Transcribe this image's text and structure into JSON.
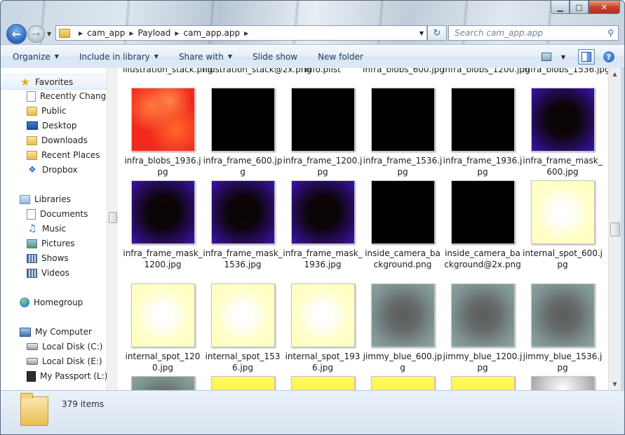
{
  "window": {
    "caption_buttons": {
      "minimize": "▁",
      "maximize": "□",
      "close": "✕"
    }
  },
  "address": {
    "crumbs": [
      "cam_app",
      "Payload",
      "cam_app.app"
    ]
  },
  "search": {
    "placeholder": "Search cam_app.app"
  },
  "toolbar": {
    "organize": "Organize",
    "include_in_library": "Include in library",
    "share_with": "Share with",
    "slide_show": "Slide show",
    "new_folder": "New folder"
  },
  "sidebar": {
    "favorites": "Favorites",
    "favorites_items": [
      "Recently Changed",
      "Public",
      "Desktop",
      "Downloads",
      "Recent Places",
      "Dropbox"
    ],
    "libraries": "Libraries",
    "libraries_items": [
      "Documents",
      "Music",
      "Pictures",
      "Shows",
      "Videos"
    ],
    "homegroup": "Homegroup",
    "computer": "My Computer",
    "computer_items": [
      "Local Disk (C:)",
      "Local Disk (E:)",
      "My Passport (L:)"
    ]
  },
  "files": {
    "partial_row": [
      "illustration_stack.png",
      "illustration_stack@2x.png",
      "Info.plist",
      "infra_blobs_600.jpg",
      "infra_blobs_1200.jpg",
      "infra_blobs_1536.jpg"
    ],
    "rows": [
      [
        {
          "name": "infra_blobs_1936.jpg",
          "thumb": "red-blobs"
        },
        {
          "name": "infra_frame_600.jpg",
          "thumb": "black"
        },
        {
          "name": "infra_frame_1200.jpg",
          "thumb": "black"
        },
        {
          "name": "infra_frame_1536.jpg",
          "thumb": "black"
        },
        {
          "name": "infra_frame_1936.jpg",
          "thumb": "black"
        },
        {
          "name": "infra_frame_mask_600.jpg",
          "thumb": "purple-vignette"
        }
      ],
      [
        {
          "name": "infra_frame_mask_1200.jpg",
          "thumb": "purple-vignette"
        },
        {
          "name": "infra_frame_mask_1536.jpg",
          "thumb": "purple-vignette"
        },
        {
          "name": "infra_frame_mask_1936.jpg",
          "thumb": "purple-vignette"
        },
        {
          "name": "inside_camera_background.png",
          "thumb": "black"
        },
        {
          "name": "inside_camera_background@2x.png",
          "thumb": "black"
        },
        {
          "name": "internal_spot_600.jpg",
          "thumb": "yellow-spot"
        }
      ],
      [
        {
          "name": "internal_spot_1200.jpg",
          "thumb": "yellow-spot"
        },
        {
          "name": "internal_spot_1536.jpg",
          "thumb": "yellow-spot"
        },
        {
          "name": "internal_spot_1936.jpg",
          "thumb": "yellow-spot"
        },
        {
          "name": "jimmy_blue_600.jpg",
          "thumb": "teal-vignette"
        },
        {
          "name": "jimmy_blue_1200.jpg",
          "thumb": "teal-vignette"
        },
        {
          "name": "jimmy_blue_1536.jpg",
          "thumb": "teal-vignette"
        }
      ],
      [
        {
          "name": "",
          "thumb": "teal-vignette"
        },
        {
          "name": "",
          "thumb": "yellow-solid"
        },
        {
          "name": "",
          "thumb": "yellow-solid"
        },
        {
          "name": "",
          "thumb": "yellow-solid"
        },
        {
          "name": "",
          "thumb": "yellow-solid"
        },
        {
          "name": "",
          "thumb": "gray-spot"
        }
      ]
    ]
  },
  "status": {
    "item_count": "379 items"
  }
}
